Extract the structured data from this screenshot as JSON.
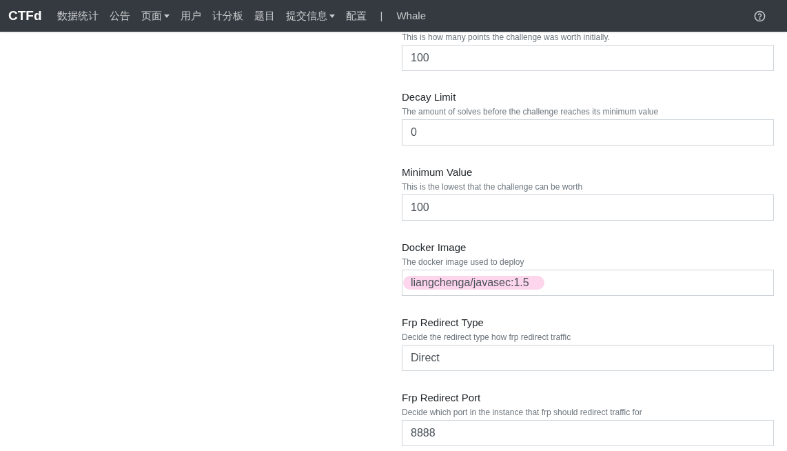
{
  "navbar": {
    "brand": "CTFd",
    "items": [
      {
        "label": "数据统计",
        "dropdown": false
      },
      {
        "label": "公告",
        "dropdown": false
      },
      {
        "label": "页面",
        "dropdown": true
      },
      {
        "label": "用户",
        "dropdown": false
      },
      {
        "label": "计分板",
        "dropdown": false
      },
      {
        "label": "题目",
        "dropdown": false
      },
      {
        "label": "提交信息",
        "dropdown": true
      },
      {
        "label": "配置",
        "dropdown": false
      }
    ],
    "separator": "|",
    "plugin": "Whale"
  },
  "fields": [
    {
      "description": "This is how many points the challenge was worth initially.",
      "value": "100",
      "highlighted": false
    },
    {
      "label": "Decay Limit",
      "description": "The amount of solves before the challenge reaches its minimum value",
      "value": "0",
      "highlighted": false
    },
    {
      "label": "Minimum Value",
      "description": "This is the lowest that the challenge can be worth",
      "value": "100",
      "highlighted": false
    },
    {
      "label": "Docker Image",
      "description": "The docker image used to deploy",
      "value": "liangchenga/javasec:1.5",
      "highlighted": true
    },
    {
      "label": "Frp Redirect Type",
      "description": "Decide the redirect type how frp redirect traffic",
      "value": "Direct",
      "highlighted": false
    },
    {
      "label": "Frp Redirect Port",
      "description": "Decide which port in the instance that frp should redirect traffic for",
      "value": "8888",
      "highlighted": false
    }
  ]
}
